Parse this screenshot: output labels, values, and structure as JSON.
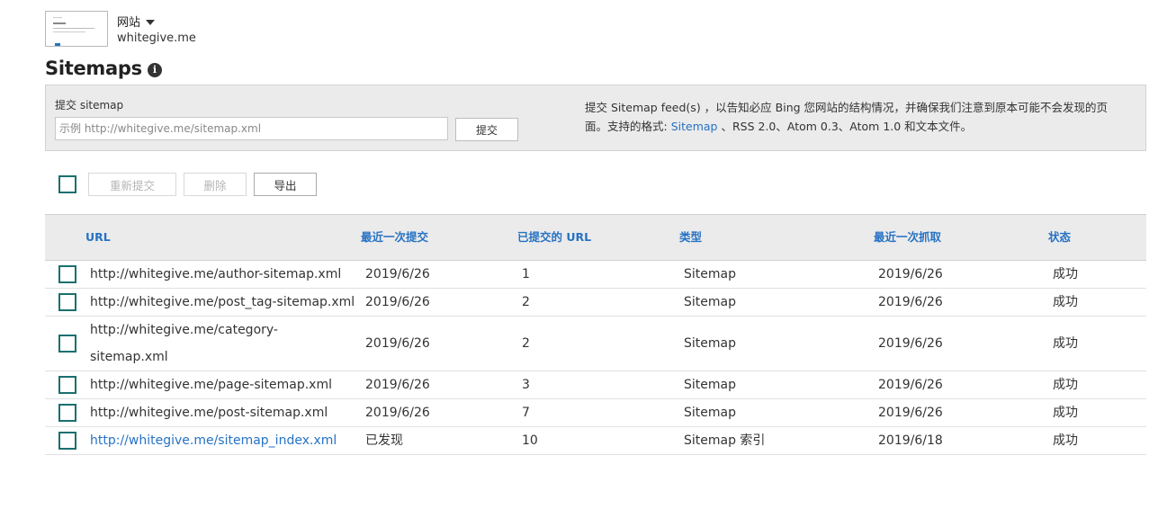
{
  "site": {
    "switch_label": "网站",
    "domain": "whitegive.me"
  },
  "page": {
    "title": "Sitemaps",
    "info_glyph": "i"
  },
  "submit": {
    "label": "提交 sitemap",
    "placeholder": "示例 http://whitegive.me/sitemap.xml",
    "value": "",
    "button": "提交",
    "help_text": "提交 Sitemap feed(s) ，以告知必应 Bing 您网站的结构情况，并确保我们注意到原本可能不会发现的页面。支持的格式:",
    "help_link": "Sitemap",
    "help_tail": "、RSS 2.0、Atom 0.3、Atom 1.0 和文本文件。"
  },
  "toolbar": {
    "resubmit": "重新提交",
    "delete": "删除",
    "export": "导出"
  },
  "table": {
    "headers": [
      "URL",
      "最近一次提交",
      "已提交的 URL",
      "类型",
      "最近一次抓取",
      "状态"
    ],
    "rows": [
      {
        "url": "http://whitegive.me/author-sitemap.xml",
        "last_submitted": "2019/6/26",
        "submitted_urls": "1",
        "type": "Sitemap",
        "last_crawled": "2019/6/26",
        "status": "成功"
      },
      {
        "url": "http://whitegive.me/post_tag-sitemap.xml",
        "last_submitted": "2019/6/26",
        "submitted_urls": "2",
        "type": "Sitemap",
        "last_crawled": "2019/6/26",
        "status": "成功"
      },
      {
        "url": "http://whitegive.me/category-sitemap.xml",
        "last_submitted": "2019/6/26",
        "submitted_urls": "2",
        "type": "Sitemap",
        "last_crawled": "2019/6/26",
        "status": "成功"
      },
      {
        "url": "http://whitegive.me/page-sitemap.xml",
        "last_submitted": "2019/6/26",
        "submitted_urls": "3",
        "type": "Sitemap",
        "last_crawled": "2019/6/26",
        "status": "成功"
      },
      {
        "url": "http://whitegive.me/post-sitemap.xml",
        "last_submitted": "2019/6/26",
        "submitted_urls": "7",
        "type": "Sitemap",
        "last_crawled": "2019/6/26",
        "status": "成功"
      },
      {
        "url": "http://whitegive.me/sitemap_index.xml",
        "last_submitted": "已发现",
        "submitted_urls": "10",
        "type": "Sitemap 索引",
        "last_crawled": "2019/6/18",
        "status": "成功"
      }
    ]
  },
  "colors": {
    "link": "#2672c4",
    "checkbox_border": "#1b6f6f",
    "panel_bg": "#ebebeb"
  }
}
